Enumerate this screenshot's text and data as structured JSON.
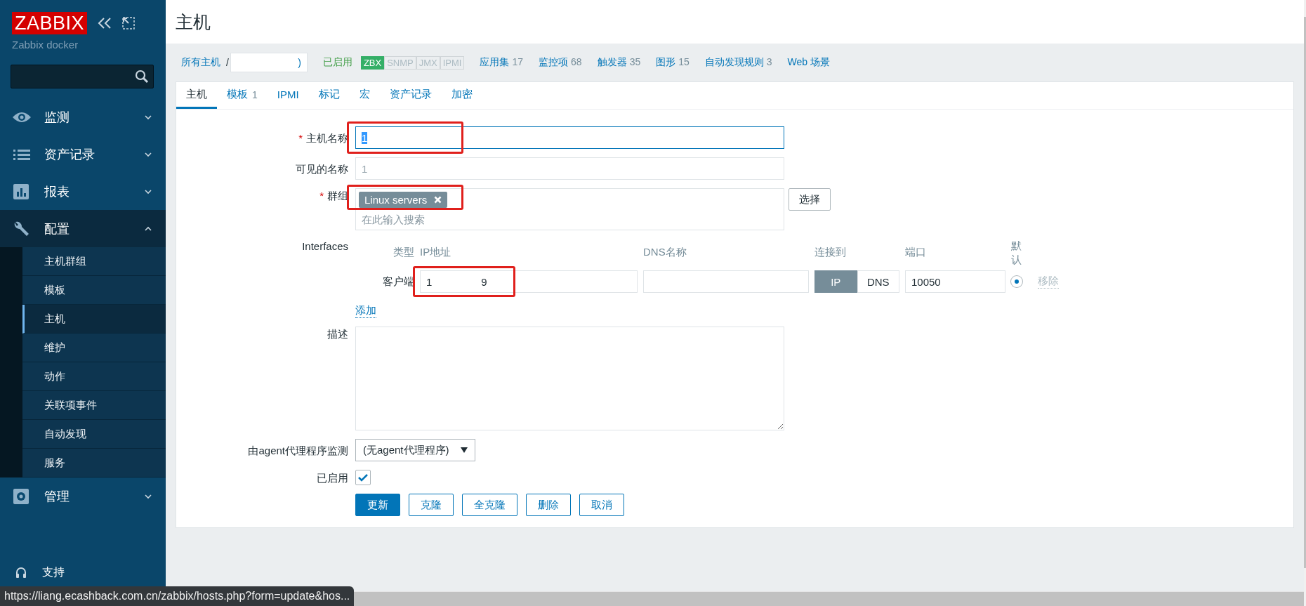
{
  "sidebar": {
    "logo": "ZABBIX",
    "subtitle": "Zabbix docker",
    "menu": [
      {
        "label": "监测",
        "expanded": false
      },
      {
        "label": "资产记录",
        "expanded": false
      },
      {
        "label": "报表",
        "expanded": false
      },
      {
        "label": "配置",
        "expanded": true,
        "children": [
          {
            "label": "主机群组",
            "selected": false
          },
          {
            "label": "模板",
            "selected": false
          },
          {
            "label": "主机",
            "selected": true
          },
          {
            "label": "维护",
            "selected": false
          },
          {
            "label": "动作",
            "selected": false
          },
          {
            "label": "关联项事件",
            "selected": false
          },
          {
            "label": "自动发现",
            "selected": false
          },
          {
            "label": "服务",
            "selected": false
          }
        ]
      },
      {
        "label": "管理",
        "expanded": false
      }
    ],
    "support": "支持"
  },
  "page_title": "主机",
  "nav": {
    "all_hosts": "所有主机",
    "separator": "/",
    "host_crumb": ")",
    "status": "已启用",
    "availability": [
      {
        "label": "ZBX",
        "on": true
      },
      {
        "label": "SNMP",
        "on": false
      },
      {
        "label": "JMX",
        "on": false
      },
      {
        "label": "IPMI",
        "on": false
      }
    ],
    "links": [
      {
        "label": "应用集",
        "count": "17"
      },
      {
        "label": "监控项",
        "count": "68"
      },
      {
        "label": "触发器",
        "count": "35"
      },
      {
        "label": "图形",
        "count": "15"
      },
      {
        "label": "自动发现规则",
        "count": "3"
      },
      {
        "label": "Web 场景"
      }
    ]
  },
  "tabs": [
    {
      "label": "主机",
      "selected": true
    },
    {
      "label": "模板",
      "count": "1",
      "selected": false
    },
    {
      "label": "IPMI",
      "selected": false
    },
    {
      "label": "标记",
      "selected": false
    },
    {
      "label": "宏",
      "selected": false
    },
    {
      "label": "资产记录",
      "selected": false
    },
    {
      "label": "加密",
      "selected": false
    }
  ],
  "form": {
    "host_name": {
      "label": "主机名称",
      "required_mark": "*",
      "value": "1",
      "highlighted": true
    },
    "visible_name": {
      "label": "可见的名称",
      "placeholder": "1"
    },
    "groups": {
      "label": "群组",
      "required_mark": "*",
      "tags": [
        "Linux servers"
      ],
      "placeholder": "在此输入搜索",
      "button": "选择",
      "highlighted": true
    },
    "interfaces": {
      "label": "Interfaces",
      "headers": [
        "类型",
        "IP地址",
        "DNS名称",
        "连接到",
        "端口",
        "默认"
      ],
      "rows": [
        {
          "type": "客户端",
          "ip_start": "1",
          "ip_end": "9",
          "highlighted": true,
          "dns": "",
          "connect": [
            {
              "label": "IP",
              "selected": true
            },
            {
              "label": "DNS",
              "selected": false
            }
          ],
          "port": "10050",
          "default": true,
          "remove": "移除"
        }
      ],
      "add": "添加"
    },
    "description": {
      "label": "描述"
    },
    "proxy": {
      "label": "由agent代理程序监测",
      "value": "(无agent代理程序)"
    },
    "enabled": {
      "label": "已启用",
      "checked": true
    },
    "buttons": [
      {
        "label": "更新",
        "kind": "primary"
      },
      {
        "label": "克隆",
        "kind": "secondary"
      },
      {
        "label": "全克隆",
        "kind": "secondary"
      },
      {
        "label": "删除",
        "kind": "secondary"
      },
      {
        "label": "取消",
        "kind": "secondary"
      }
    ]
  },
  "status_url": "https://liang.ecashback.com.cn/zabbix/hosts.php?form=update&hos..."
}
